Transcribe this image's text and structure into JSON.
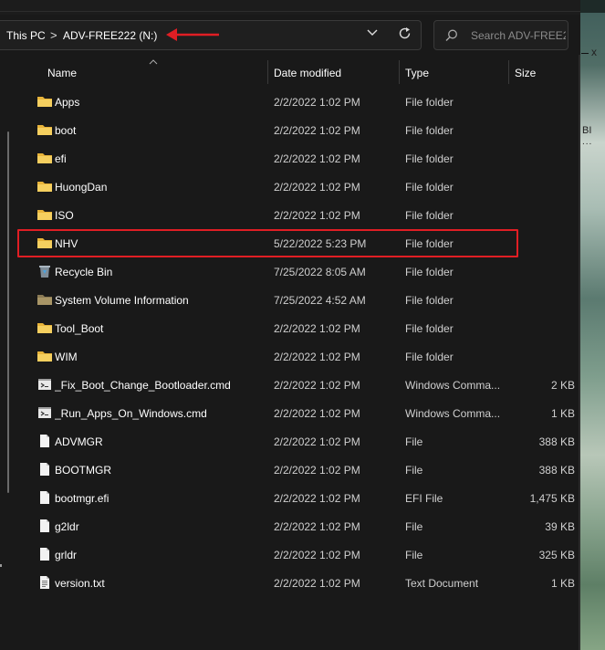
{
  "address": {
    "crumb_root": "This PC",
    "crumb_sep": ">",
    "crumb_drive": "ADV-FREE222 (N:)"
  },
  "search": {
    "placeholder": "Search ADV-FREE2..."
  },
  "columns": {
    "name": "Name",
    "date": "Date modified",
    "type": "Type",
    "size": "Size"
  },
  "side_panel": {
    "close": "x",
    "text1": "BI",
    "text2": "..."
  },
  "files": [
    {
      "name": "Apps",
      "date": "2/2/2022 1:02 PM",
      "type": "File folder",
      "size": "",
      "icon": "folder-icon"
    },
    {
      "name": "boot",
      "date": "2/2/2022 1:02 PM",
      "type": "File folder",
      "size": "",
      "icon": "folder-icon"
    },
    {
      "name": "efi",
      "date": "2/2/2022 1:02 PM",
      "type": "File folder",
      "size": "",
      "icon": "folder-icon"
    },
    {
      "name": "HuongDan",
      "date": "2/2/2022 1:02 PM",
      "type": "File folder",
      "size": "",
      "icon": "folder-icon"
    },
    {
      "name": "ISO",
      "date": "2/2/2022 1:02 PM",
      "type": "File folder",
      "size": "",
      "icon": "folder-icon"
    },
    {
      "name": "NHV",
      "date": "5/22/2022 5:23 PM",
      "type": "File folder",
      "size": "",
      "icon": "folder-icon"
    },
    {
      "name": "Recycle Bin",
      "date": "7/25/2022 8:05 AM",
      "type": "File folder",
      "size": "",
      "icon": "recycle-bin-icon"
    },
    {
      "name": "System Volume Information",
      "date": "7/25/2022 4:52 AM",
      "type": "File folder",
      "size": "",
      "icon": "system-folder-icon"
    },
    {
      "name": "Tool_Boot",
      "date": "2/2/2022 1:02 PM",
      "type": "File folder",
      "size": "",
      "icon": "folder-icon"
    },
    {
      "name": "WIM",
      "date": "2/2/2022 1:02 PM",
      "type": "File folder",
      "size": "",
      "icon": "folder-icon"
    },
    {
      "name": "_Fix_Boot_Change_Bootloader.cmd",
      "date": "2/2/2022 1:02 PM",
      "type": "Windows Comma...",
      "size": "2 KB",
      "icon": "cmd-file-icon"
    },
    {
      "name": "_Run_Apps_On_Windows.cmd",
      "date": "2/2/2022 1:02 PM",
      "type": "Windows Comma...",
      "size": "1 KB",
      "icon": "cmd-file-icon"
    },
    {
      "name": "ADVMGR",
      "date": "2/2/2022 1:02 PM",
      "type": "File",
      "size": "388 KB",
      "icon": "file-icon"
    },
    {
      "name": "BOOTMGR",
      "date": "2/2/2022 1:02 PM",
      "type": "File",
      "size": "388 KB",
      "icon": "file-icon"
    },
    {
      "name": "bootmgr.efi",
      "date": "2/2/2022 1:02 PM",
      "type": "EFI File",
      "size": "1,475 KB",
      "icon": "file-icon"
    },
    {
      "name": "g2ldr",
      "date": "2/2/2022 1:02 PM",
      "type": "File",
      "size": "39 KB",
      "icon": "file-icon"
    },
    {
      "name": "grldr",
      "date": "2/2/2022 1:02 PM",
      "type": "File",
      "size": "325 KB",
      "icon": "file-icon"
    },
    {
      "name": "version.txt",
      "date": "2/2/2022 1:02 PM",
      "type": "Text Document",
      "size": "1 KB",
      "icon": "text-file-icon"
    }
  ],
  "colors": {
    "highlight": "#e01e24",
    "folder": "#f2c94c",
    "background": "#191919"
  }
}
